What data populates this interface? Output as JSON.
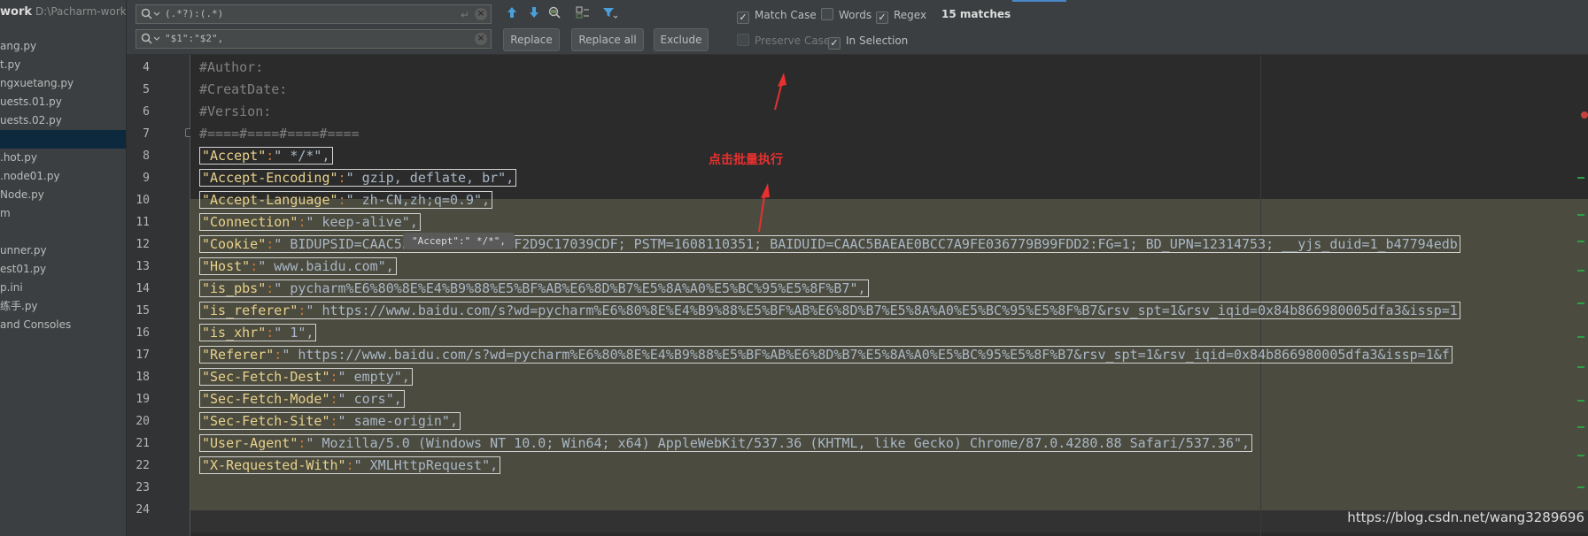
{
  "project": {
    "name": "work",
    "path": "D:\\Pacharm-work",
    "items": [
      {
        "label": "ang.py",
        "selected": false
      },
      {
        "label": "t.py",
        "selected": false
      },
      {
        "label": "ngxuetang.py",
        "selected": false
      },
      {
        "label": "uests.01.py",
        "selected": false
      },
      {
        "label": "uests.02.py",
        "selected": false
      },
      {
        "label": "",
        "selected": true
      },
      {
        "label": ".hot.py",
        "selected": false
      },
      {
        "label": ".node01.py",
        "selected": false
      },
      {
        "label": "Node.py",
        "selected": false
      },
      {
        "label": "m",
        "selected": false
      },
      {
        "label": "",
        "selected": false
      },
      {
        "label": "unner.py",
        "selected": false
      },
      {
        "label": "est01.py",
        "selected": false
      },
      {
        "label": "p.ini",
        "selected": false
      },
      {
        "label": "练手.py",
        "selected": false
      },
      {
        "label": "and Consoles",
        "selected": false
      }
    ]
  },
  "find": {
    "search_value": "(.*?):(.*)",
    "replace_value": "\"$1\":\"$2\",",
    "replace_label": "Replace",
    "replace_all_label": "Replace all",
    "exclude_label": "Exclude",
    "match_case_label": "Match Case",
    "match_case_checked": true,
    "words_label": "Words",
    "words_checked": false,
    "regex_label": "Regex",
    "regex_checked": true,
    "preserve_case_label": "Preserve Case",
    "preserve_case_checked": false,
    "in_selection_label": "In Selection",
    "in_selection_checked": true,
    "matches_text": "15 matches"
  },
  "editor": {
    "line_numbers": [
      "4",
      "5",
      "6",
      "7",
      "8",
      "9",
      "10",
      "11",
      "12",
      "13",
      "14",
      "15",
      "16",
      "17",
      "18",
      "19",
      "20",
      "21",
      "22",
      "23",
      "24"
    ],
    "comment_lines": [
      "#Author:",
      "#CreatDate:",
      "#Version:",
      "#====#====#====#===="
    ],
    "code_lines": [
      {
        "key": "\"Accept\"",
        "sep": ":",
        "value": "\" */*\"",
        "tail": ","
      },
      {
        "key": "\"Accept-Encoding\"",
        "sep": ":",
        "value": "\" gzip, deflate, br\"",
        "tail": ","
      },
      {
        "key": "\"Accept-Language\"",
        "sep": ":",
        "value": "\" zh-CN,zh;q=0.9\"",
        "tail": ","
      },
      {
        "key": "\"Connection\"",
        "sep": ":",
        "value": "\" keep-alive\"",
        "tail": ","
      },
      {
        "key": "\"Cookie\"",
        "sep": ":",
        "value": "\" BIDUPSID=CAAC5BAEAE0BCC7A044F2D9C17039CDF; PSTM=1608110351; BAIDUID=CAAC5BAEAE0BCC7A9FE036779B99FDD2:FG=1; BD_UPN=12314753; __yjs_duid=1_b47794edb",
        "tail": ""
      },
      {
        "key": "\"Host\"",
        "sep": ":",
        "value": "\" www.baidu.com\"",
        "tail": ","
      },
      {
        "key": "\"is_pbs\"",
        "sep": ":",
        "value": "\" pycharm%E6%80%8E%E4%B9%88%E5%BF%AB%E6%8D%B7%E5%8A%A0%E5%BC%95%E5%8F%B7\"",
        "tail": ","
      },
      {
        "key": "\"is_referer\"",
        "sep": ":",
        "value": "\" https://www.baidu.com/s?wd=pycharm%E6%80%8E%E4%B9%88%E5%BF%AB%E6%8D%B7%E5%8A%A0%E5%BC%95%E5%8F%B7&rsv_spt=1&rsv_iqid=0x84b866980005dfa3&issp=1",
        "tail": ""
      },
      {
        "key": "\"is_xhr\"",
        "sep": ":",
        "value": "\" 1\"",
        "tail": ","
      },
      {
        "key": "\"Referer\"",
        "sep": ":",
        "value": "\" https://www.baidu.com/s?wd=pycharm%E6%80%8E%E4%B9%88%E5%BF%AB%E6%8D%B7%E5%8A%A0%E5%BC%95%E5%8F%B7&rsv_spt=1&rsv_iqid=0x84b866980005dfa3&issp=1&f",
        "tail": ""
      },
      {
        "key": "\"Sec-Fetch-Dest\"",
        "sep": ":",
        "value": "\" empty\"",
        "tail": ","
      },
      {
        "key": "\"Sec-Fetch-Mode\"",
        "sep": ":",
        "value": "\" cors\"",
        "tail": ","
      },
      {
        "key": "\"Sec-Fetch-Site\"",
        "sep": ":",
        "value": "\" same-origin\"",
        "tail": ","
      },
      {
        "key": "\"User-Agent\"",
        "sep": ":",
        "value": "\" Mozilla/5.0 (Windows NT 10.0; Win64; x64) AppleWebKit/537.36 (KHTML, like Gecko) Chrome/87.0.4280.88 Safari/537.36\"",
        "tail": ","
      },
      {
        "key": "\"X-Requested-With\"",
        "sep": ":",
        "value": "\" XMLHttpRequest\"",
        "tail": ","
      }
    ],
    "tooltip": "\"Accept\":\" */*\","
  },
  "annotation": {
    "text": "点击批量执行",
    "color": "#e8312f"
  },
  "watermark": "https://blog.csdn.net/wang3289696",
  "colors": {
    "string": "#e8d28c",
    "operator": "#cc7832",
    "number": "#6897bb",
    "comment": "#808080",
    "selection": "#4b4b3f"
  },
  "icons": [
    "search-icon",
    "clear-icon",
    "enter-icon",
    "arrow-up-icon",
    "arrow-down-icon",
    "find-in-selection-icon",
    "multi-select-icon",
    "filter-icon"
  ]
}
